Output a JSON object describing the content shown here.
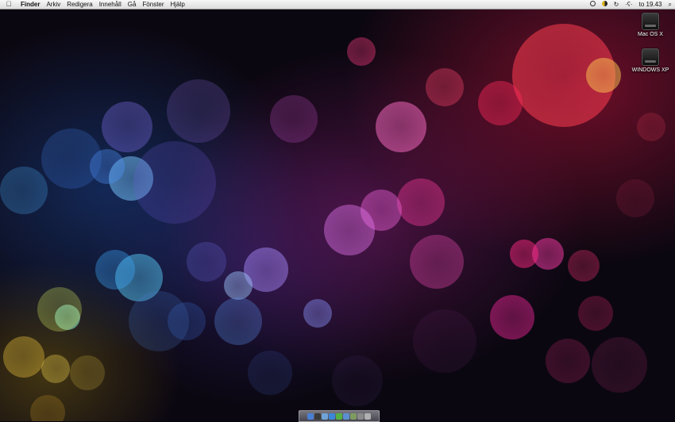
{
  "menubar": {
    "apple_icon": "apple-logo-icon",
    "items": [
      "Finder",
      "Arkiv",
      "Redigera",
      "Innehåll",
      "Gå",
      "Fönster",
      "Hjälp"
    ],
    "status": {
      "clock": "to 19.43",
      "icons": [
        "time-machine-icon",
        "moon-icon",
        "sync-icon",
        "bluetooth-icon",
        "spotlight-icon"
      ]
    }
  },
  "desktop": {
    "wallpaper": "bokeh-colored-lights",
    "icons": [
      {
        "label": "Mac OS X",
        "icon": "hard-drive-icon"
      },
      {
        "label": "WINDOWS XP",
        "icon": "hard-drive-icon"
      }
    ]
  },
  "dock": {
    "icons": [
      "finder-icon",
      "dashboard-icon",
      "mail-icon",
      "safari-icon",
      "ichat-icon",
      "itunes-icon",
      "iphoto-icon",
      "system-preferences-icon",
      "trash-icon"
    ],
    "colors": [
      "#4a7fd6",
      "#3a3a3a",
      "#6fa3d8",
      "#3c86d9",
      "#55b043",
      "#5b8fd1",
      "#7d9b62",
      "#8a8a8a",
      "#b0b0b0"
    ]
  }
}
